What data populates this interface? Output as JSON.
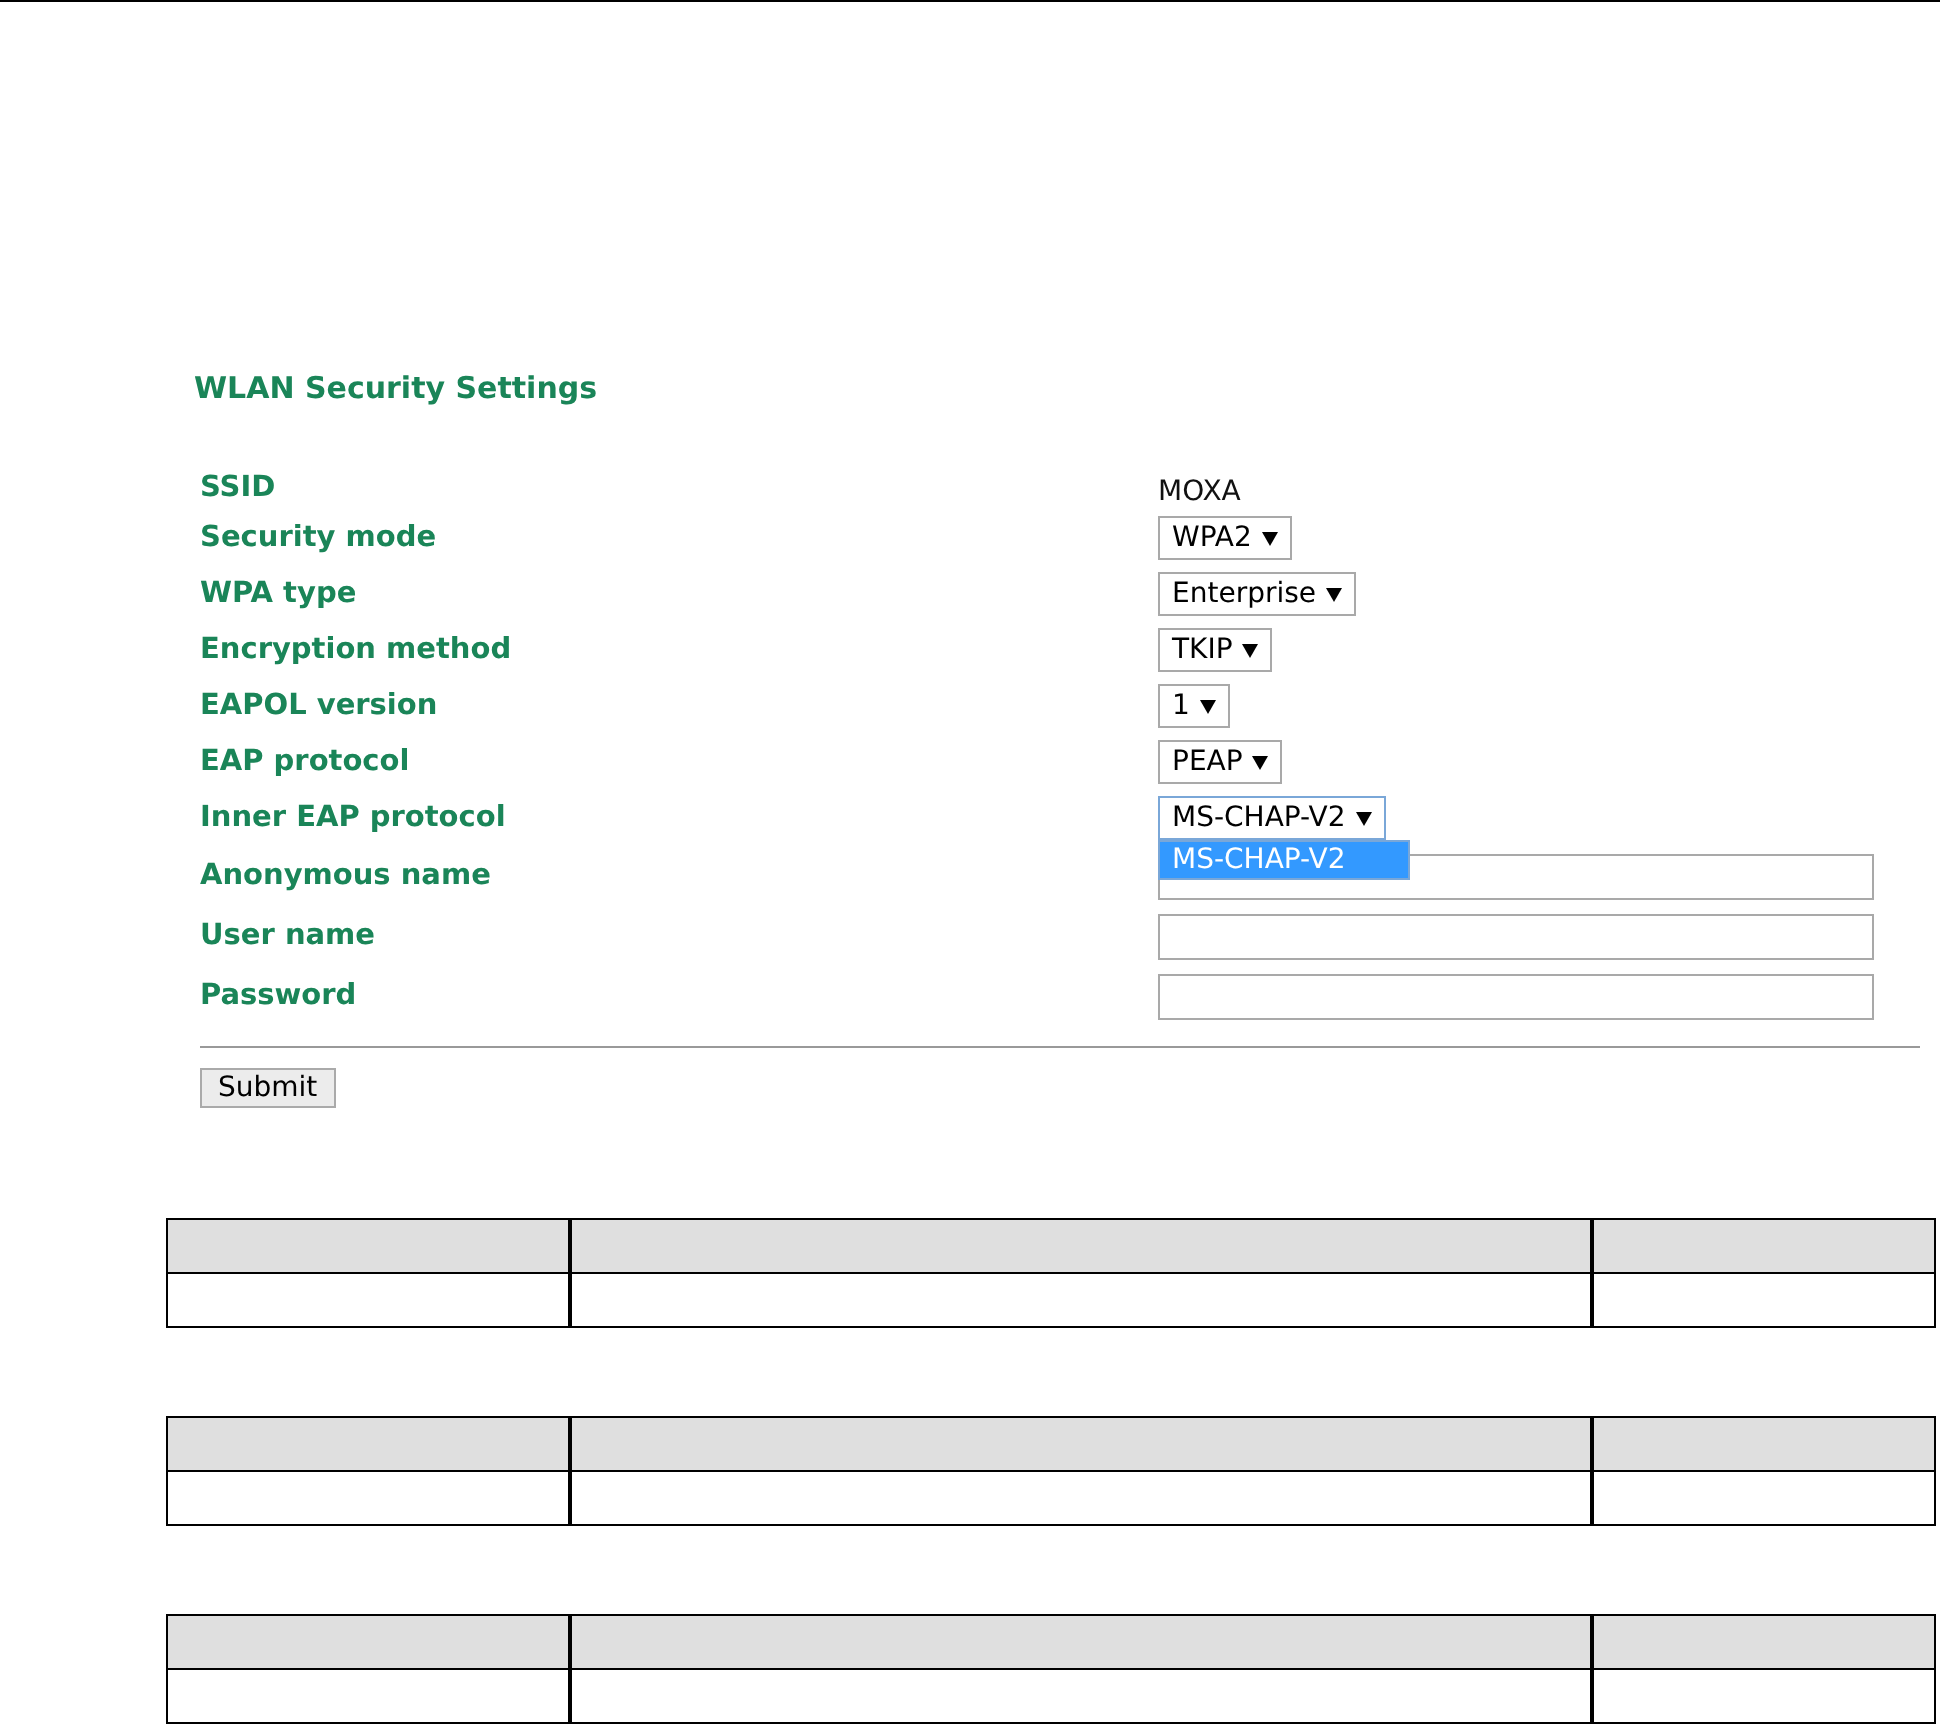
{
  "heading": "WLAN Security Settings",
  "fields": [
    {
      "label": "SSID",
      "kind": "text",
      "value": "MOXA"
    },
    {
      "label": "Security mode",
      "kind": "select",
      "value": "WPA2",
      "open": false
    },
    {
      "label": "WPA type",
      "kind": "select",
      "value": "Enterprise",
      "open": false
    },
    {
      "label": "Encryption method",
      "kind": "select",
      "value": "TKIP",
      "open": false
    },
    {
      "label": "EAPOL version",
      "kind": "select",
      "value": "1",
      "open": false
    },
    {
      "label": "EAP protocol",
      "kind": "select",
      "value": "PEAP",
      "open": false
    },
    {
      "label": "Inner EAP protocol",
      "kind": "select",
      "value": "MS-CHAP-V2",
      "open": true,
      "options": [
        {
          "label": "MS-CHAP-V2",
          "selected": true
        }
      ]
    },
    {
      "label": "Anonymous name",
      "kind": "input"
    },
    {
      "label": "User name",
      "kind": "input"
    },
    {
      "label": "Password",
      "kind": "input"
    }
  ],
  "submit": "Submit"
}
